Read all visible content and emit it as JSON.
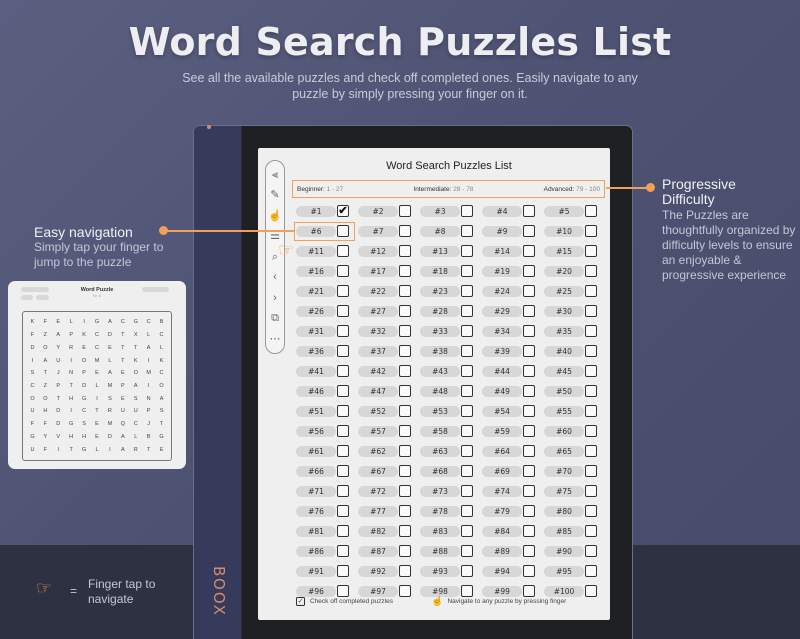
{
  "hero": {
    "title": "Word Search Puzzles List",
    "subtitle": "See all the available puzzles and check off completed ones. Easily navigate to any puzzle by simply pressing your finger on it."
  },
  "device": {
    "brand": "BOOX"
  },
  "page": {
    "title": "Word Search Puzzles List",
    "levels": [
      {
        "label": "Beginner:",
        "range": "1 - 27"
      },
      {
        "label": "Intermediate:",
        "range": "28 - 78"
      },
      {
        "label": "Advanced:",
        "range": "79 - 100"
      }
    ],
    "checked_puzzles": [
      1
    ],
    "highlighted_puzzle": 6,
    "puzzle_count": 100,
    "legend": {
      "check_label": "Check off completed puzzles",
      "navigate_label": "Navigate to any puzzle by pressing finger"
    }
  },
  "toolbar": {
    "tools": [
      {
        "name": "split-view-icon",
        "glyph": "⫷"
      },
      {
        "name": "pen-icon",
        "glyph": "✎"
      },
      {
        "name": "hand-touch-icon",
        "glyph": "☝"
      },
      {
        "name": "list-icon",
        "glyph": "☰"
      },
      {
        "name": "zoom-icon",
        "glyph": "⌕"
      },
      {
        "name": "previous-page-icon",
        "glyph": "‹"
      },
      {
        "name": "next-page-icon",
        "glyph": "›"
      },
      {
        "name": "jump-page-icon",
        "glyph": "⧉"
      },
      {
        "name": "more-icon",
        "glyph": "⋯"
      }
    ]
  },
  "callouts": {
    "navigation": {
      "title": "Easy navigation",
      "desc": "Simply tap your finger to jump to the puzzle"
    },
    "difficulty": {
      "title": "Progressive Difficulty",
      "desc": "The Puzzles are thoughtfully organized by difficulty levels to ensure an enjoyable & progressive experience"
    }
  },
  "preview": {
    "title": "Word Puzzle",
    "subtitle": "Nr. 6",
    "letters": [
      "KFELIGACGCB",
      "FZAPKCDTXLC",
      "DOYRECETTAL",
      "IAUIDMLTKIK",
      "STJNPEAEOMC",
      "CZPTDLMPAIO",
      "OOTHGISESNA",
      "UHDICTRUUPS",
      "FFDGSEMQCJT",
      "GYVHHEDALBG",
      "UFITGLIARTE"
    ]
  },
  "key": {
    "equals": "=",
    "text": "Finger tap to navigate"
  },
  "colors": {
    "accent": "#f0a05a",
    "background": "#4f5373",
    "device_spine": "#363b5c"
  }
}
